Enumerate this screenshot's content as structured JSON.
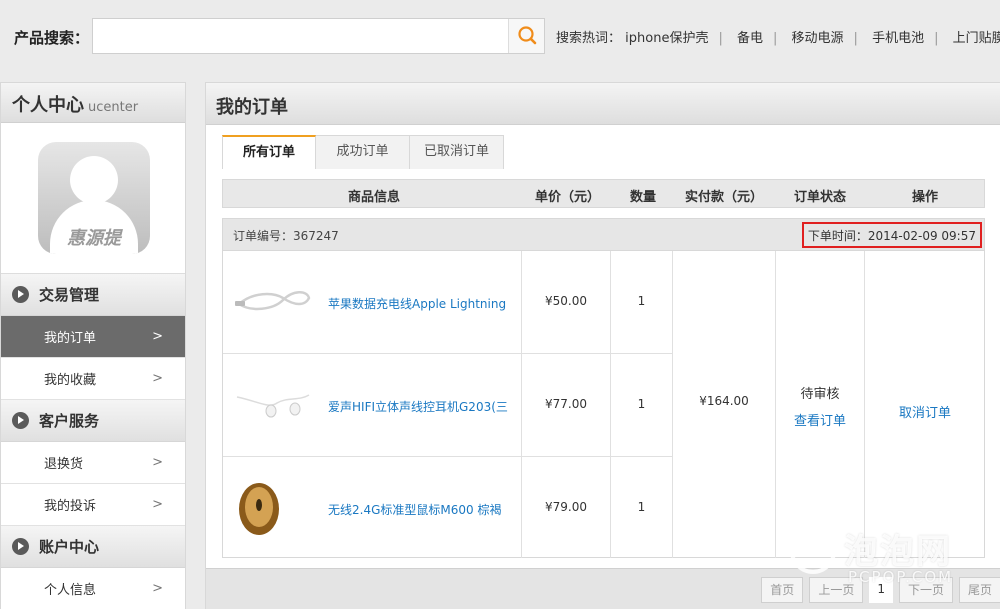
{
  "search": {
    "label": "产品搜索：",
    "value": "",
    "placeholder": "",
    "hot_label": "搜索热词：",
    "hot_words": [
      "iphone保护壳",
      "备电",
      "移动电源",
      "手机电池",
      "上门贴膜"
    ]
  },
  "sidebar": {
    "title": "个人中心",
    "subtitle": "ucenter",
    "avatar_text": "惠源提",
    "sections": [
      {
        "title": "交易管理",
        "items": [
          {
            "label": "我的订单",
            "arrow": ">"
          },
          {
            "label": "我的收藏",
            "arrow": ">"
          }
        ]
      },
      {
        "title": "客户服务",
        "items": [
          {
            "label": "退换货",
            "arrow": ">"
          },
          {
            "label": "我的投诉",
            "arrow": ">"
          }
        ]
      },
      {
        "title": "账户中心",
        "items": [
          {
            "label": "个人信息",
            "arrow": ">"
          }
        ]
      }
    ]
  },
  "main": {
    "title": "我的订单",
    "tabs": [
      "所有订单",
      "成功订单",
      "已取消订单"
    ],
    "columns": [
      "商品信息",
      "单价（元）",
      "数量",
      "实付款（元）",
      "订单状态",
      "操作"
    ],
    "order": {
      "number_label": "订单编号：367247",
      "time_label": "下单时间：2014-02-09 09:57",
      "items": [
        {
          "name": "苹果数据充电线Apple Lightning",
          "price": "¥50.00",
          "qty": "1",
          "image": "cable-image"
        },
        {
          "name": "爱声HIFI立体声线控耳机G203(三",
          "price": "¥77.00",
          "qty": "1",
          "image": "earphones-image"
        },
        {
          "name": "无线2.4G标准型鼠标M600 棕褐",
          "price": "¥79.00",
          "qty": "1",
          "image": "mouse-image"
        }
      ],
      "total": "¥164.00",
      "status": "待审核",
      "view_link": "查看订单",
      "cancel_link": "取消订单"
    },
    "pager": {
      "first": "首页",
      "prev": "上一页",
      "current": "1",
      "next": "下一页",
      "last": "尾页"
    }
  },
  "watermark": {
    "text": "泡泡网",
    "sub": "PCPOP.COM"
  },
  "colors": {
    "accent": "#f0a020",
    "link": "#1a78c2",
    "highlight": "#e02020",
    "active_menu": "#6b6b6b"
  }
}
